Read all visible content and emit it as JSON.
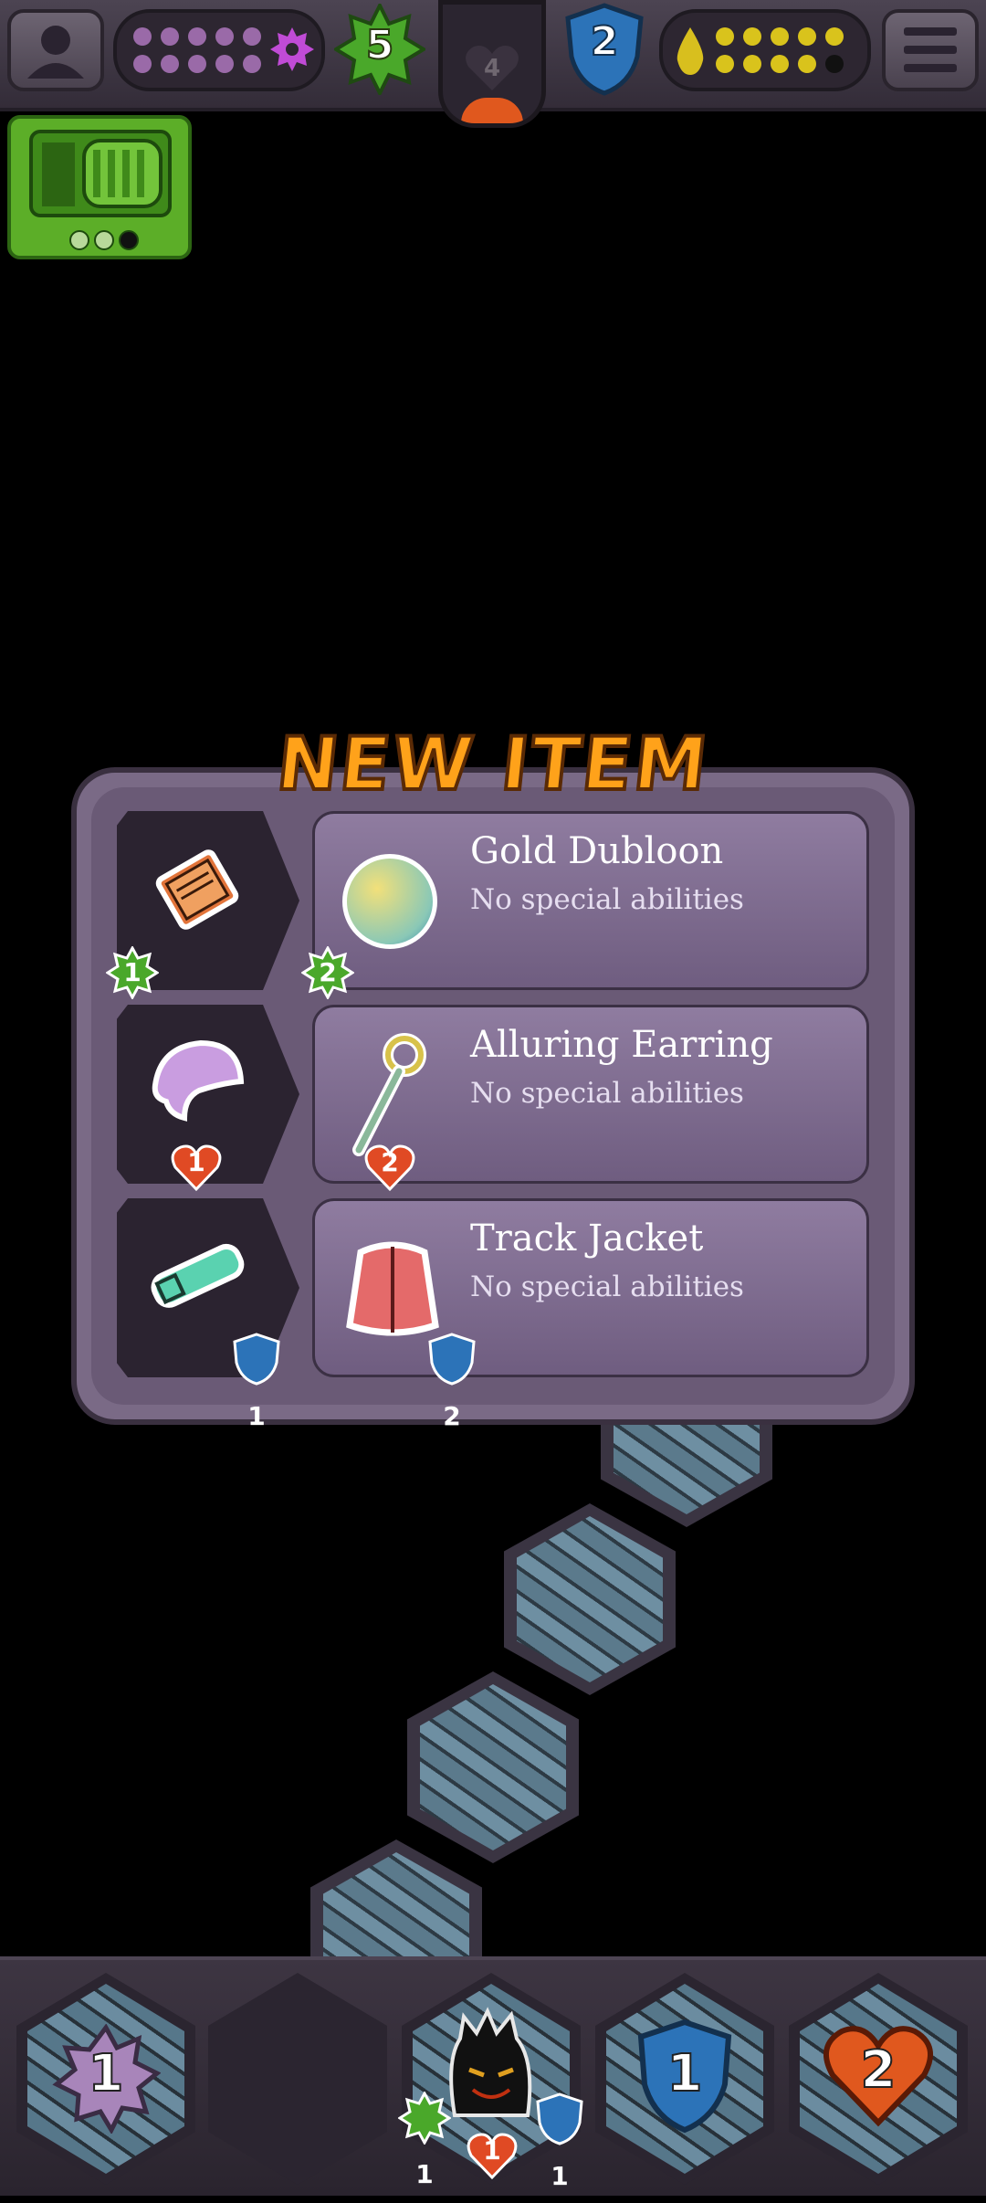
{
  "top_bar": {
    "profile_icon": "person-icon",
    "gear_pips": {
      "filled_color": "#b06ac8",
      "count": 10
    },
    "level_star_value": "5",
    "center_counter": "4",
    "shield_value": "2",
    "drop_pips": {
      "filled_color": "#d9c31c",
      "empty_color": "#111111",
      "count": 10,
      "filled": 9
    },
    "menu_icon": "hamburger-menu-icon"
  },
  "tv_widget": {
    "icon": "retro-tv-icon",
    "dots": 3
  },
  "new_item": {
    "title": "NEW ITEM",
    "rows": [
      {
        "old_icon": "book-icon",
        "old_badge": "1",
        "old_badge_type": "star",
        "name": "Gold Dubloon",
        "desc": "No special abilities",
        "new_icon": "coin-icon",
        "new_badge": "2",
        "new_badge_type": "star"
      },
      {
        "old_icon": "bandana-icon",
        "old_badge": "1",
        "old_badge_type": "heart",
        "name": "Alluring Earring",
        "desc": "No special abilities",
        "new_icon": "earring-icon",
        "new_badge": "2",
        "new_badge_type": "heart"
      },
      {
        "old_icon": "belt-icon",
        "old_badge": "1",
        "old_badge_type": "shield",
        "name": "Track Jacket",
        "desc": "No special abilities",
        "new_icon": "jacket-icon",
        "new_badge": "2",
        "new_badge_type": "shield"
      }
    ]
  },
  "bottom_bar": {
    "gear_value": "1",
    "player": {
      "icon": "monster-avatar-icon",
      "star": "1",
      "heart": "1",
      "shield": "1"
    },
    "shield_value": "1",
    "heart_value": "2"
  }
}
